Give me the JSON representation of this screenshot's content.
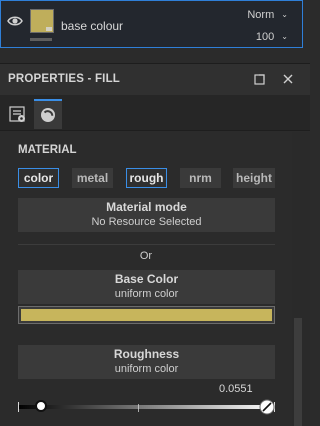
{
  "layer": {
    "name": "base colour",
    "blend_mode": "Norm",
    "opacity": "100",
    "thumbnail_color": "#bfae5b"
  },
  "panel": {
    "title": "PROPERTIES - FILL"
  },
  "material": {
    "section_title": "MATERIAL",
    "channels": [
      {
        "label": "color",
        "active": true
      },
      {
        "label": "metal",
        "active": false
      },
      {
        "label": "rough",
        "active": true
      },
      {
        "label": "nrm",
        "active": false
      },
      {
        "label": "height",
        "active": false
      }
    ],
    "material_mode": {
      "title": "Material mode",
      "value": "No Resource Selected"
    },
    "or_label": "Or",
    "base_color": {
      "title": "Base Color",
      "subtitle": "uniform color",
      "color": "#c7b55c"
    },
    "roughness": {
      "title": "Roughness",
      "subtitle": "uniform color",
      "value_label": "0.0551",
      "value": 0.0551
    }
  },
  "colors": {
    "accent": "#3a8ee6"
  }
}
